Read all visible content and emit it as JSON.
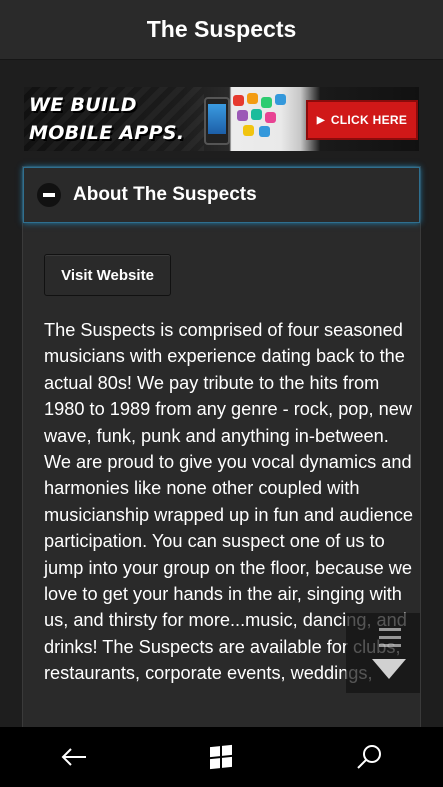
{
  "header": {
    "title": "The Suspects"
  },
  "banner": {
    "slogan": "WE BUILD MOBILE APPS.",
    "cta_label": "CLICK HERE",
    "app_colors": [
      "#e63a2e",
      "#f39c12",
      "#2ecc71",
      "#3498db",
      "#9b59b6",
      "#1abc9c",
      "#e84393",
      "#f1c40f"
    ]
  },
  "panel": {
    "title": "About The Suspects",
    "button_label": "Visit Website",
    "description": "The Suspects is comprised of four seasoned musicians with experience dating back to the actual 80s! We pay tribute to the hits from 1980 to 1989 from any genre - rock, pop, new wave, funk, punk and anything in-between. We are proud to give you vocal dynamics and harmonies like none other coupled with musicianship wrapped up in fun and audience participation. You can suspect one of us to jump into your group on the floor, because we love to get your hands in the air, singing with us, and thirsty for more...music, dancing, and drinks! The Suspects are available for clubs, restaurants, corporate events, weddings,"
  },
  "navbar": {
    "icons": [
      "back-arrow-icon",
      "windows-logo-icon",
      "search-icon"
    ]
  },
  "colors": {
    "accent_glow": "#1f7fb0",
    "cta_red": "#d01818"
  }
}
